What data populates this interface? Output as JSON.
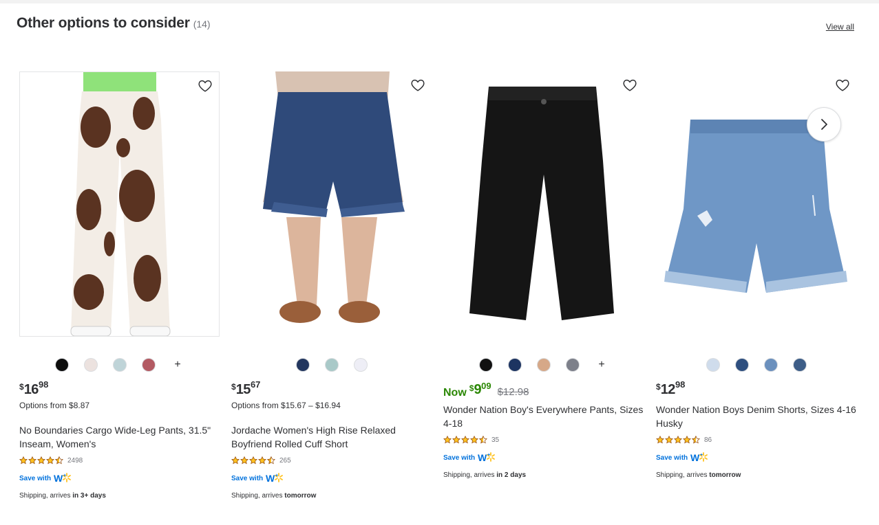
{
  "header": {
    "title": "Other options to consider",
    "count": "(14)",
    "view_all": "View all"
  },
  "colors": {
    "accent_green": "#2a8703",
    "walmart_blue": "#0071dc",
    "spark_yellow": "#ffc220"
  },
  "products": [
    {
      "swatches": [
        "#0d0d0d",
        "#ece2df",
        "#bfd4d8",
        "#b35a63"
      ],
      "has_more_swatches": true,
      "more_label": "+",
      "price": {
        "currency": "$",
        "dollars": "16",
        "cents": "98"
      },
      "options_text": "Options from $8.87",
      "title": "No Boundaries Cargo Wide-Leg Pants, 31.5\" Inseam, Women's",
      "rating": 4.5,
      "review_count": "2498",
      "save_with": "Save with",
      "shipping_prefix": "Shipping, arrives ",
      "shipping_when": "in 3+ days",
      "icon": "heart-outline-icon"
    },
    {
      "swatches": [
        "#23375f",
        "#a9c9c8",
        "#eeeef6"
      ],
      "has_more_swatches": false,
      "price": {
        "currency": "$",
        "dollars": "15",
        "cents": "67"
      },
      "options_text": "Options from $15.67 – $16.94",
      "title": "Jordache Women's High Rise Relaxed Boyfriend Rolled Cuff Short",
      "rating": 4.5,
      "review_count": "265",
      "save_with": "Save with",
      "shipping_prefix": "Shipping, arrives ",
      "shipping_when": "tomorrow",
      "icon": "heart-outline-icon"
    },
    {
      "swatches": [
        "#111111",
        "#1d3461",
        "#d6a888",
        "#7d808a"
      ],
      "has_more_swatches": true,
      "more_label": "+",
      "now_label": "Now",
      "price": {
        "currency": "$",
        "dollars": "9",
        "cents": "09"
      },
      "was_price": "$12.98",
      "title": "Wonder Nation Boy's Everywhere Pants, Sizes 4-18",
      "rating": 4.5,
      "review_count": "35",
      "save_with": "Save with",
      "shipping_prefix": "Shipping, arrives ",
      "shipping_when": "in 2 days",
      "icon": "heart-outline-icon"
    },
    {
      "swatches": [
        "#cfdcec",
        "#2e4f7f",
        "#6b90bd",
        "#3d5d87"
      ],
      "has_more_swatches": false,
      "price": {
        "currency": "$",
        "dollars": "12",
        "cents": "98"
      },
      "title": "Wonder Nation Boys Denim Shorts, Sizes 4-16 Husky",
      "rating": 4.5,
      "review_count": "86",
      "save_with": "Save with",
      "shipping_prefix": "Shipping, arrives ",
      "shipping_when": "tomorrow",
      "icon": "heart-outline-icon"
    }
  ],
  "carousel": {
    "next_icon": "chevron-right-icon"
  }
}
